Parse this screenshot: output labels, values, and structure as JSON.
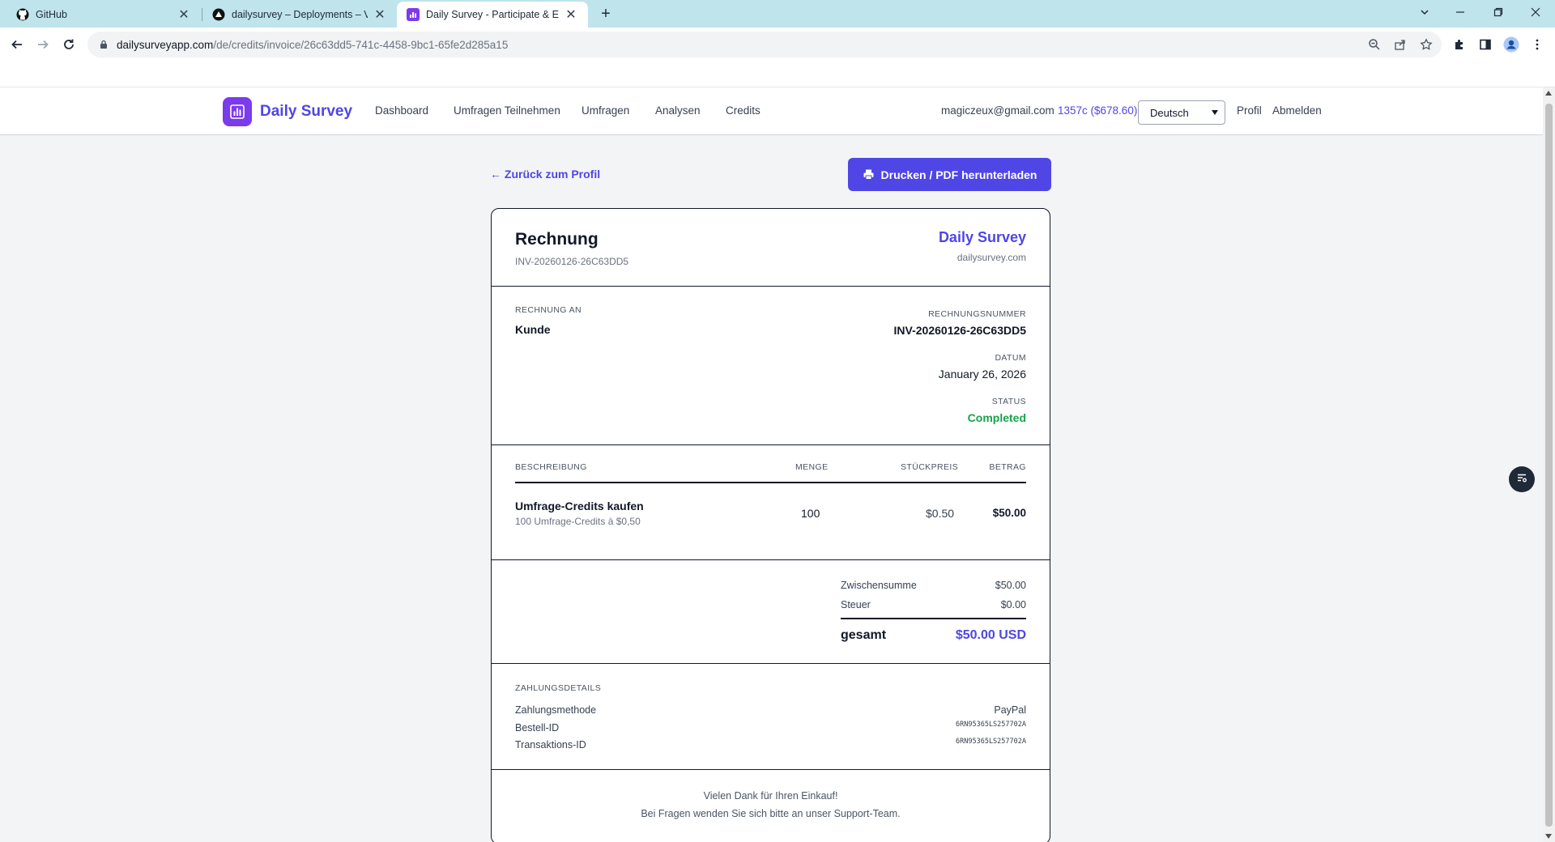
{
  "browser": {
    "tabs": [
      {
        "title": "GitHub",
        "icon": "github-icon"
      },
      {
        "title": "dailysurvey – Deployments – Ve",
        "icon": "vercel-icon"
      },
      {
        "title": "Daily Survey - Participate & Earn",
        "icon": "dailysurvey-favicon"
      }
    ],
    "url_host": "dailysurveyapp.com",
    "url_path": "/de/credits/invoice/26c63dd5-741c-4458-9bc1-65fe2d285a15"
  },
  "nav": {
    "brand": "Daily Survey",
    "links": [
      "Dashboard",
      "Umfragen Teilnehmen",
      "Umfragen",
      "Analysen",
      "Credits"
    ],
    "email": "magiczeux@gmail.com",
    "credits": "1357c ($678.60)",
    "language": "Deutsch",
    "profile": "Profil",
    "logout": "Abmelden"
  },
  "page": {
    "back_link": "← Zurück zum Profil",
    "print_button": "Drucken / PDF herunterladen"
  },
  "invoice": {
    "title": "Rechnung",
    "number_sub": "INV-20260126-26C63DD5",
    "brand": "Daily Survey",
    "domain": "dailysurvey.com",
    "bill_to_label": "RECHNUNG AN",
    "bill_to_value": "Kunde",
    "invoice_number_label": "RECHNUNGSNUMMER",
    "invoice_number": "INV-20260126-26C63DD5",
    "date_label": "DATUM",
    "date": "January 26, 2026",
    "status_label": "STATUS",
    "status": "Completed",
    "table": {
      "headers": [
        "BESCHREIBUNG",
        "MENGE",
        "STÜCKPREIS",
        "BETRAG"
      ],
      "rows": [
        {
          "description": "Umfrage-Credits kaufen",
          "detail": "100 Umfrage-Credits à $0,50",
          "quantity": "100",
          "unit_price": "$0.50",
          "amount": "$50.00"
        }
      ]
    },
    "totals": {
      "subtotal_label": "Zwischensumme",
      "subtotal": "$50.00",
      "tax_label": "Steuer",
      "tax": "$0.00",
      "total_label": "gesamt",
      "total": "$50.00 USD"
    },
    "payment": {
      "section_label": "ZAHLUNGSDETAILS",
      "method_label": "Zahlungsmethode",
      "method": "PayPal",
      "order_id_label": "Bestell-ID",
      "order_id": "6RN95365LS257702A",
      "transaction_id_label": "Transaktions-ID",
      "transaction_id": "6RN95365LS257702A"
    },
    "footer": {
      "line1": "Vielen Dank für Ihren Einkauf!",
      "line2": "Bei Fragen wenden Sie sich bitte an unser Support-Team."
    }
  },
  "colors": {
    "accent": "#4f46e5",
    "status_completed": "#16a34a",
    "tabstrip": "#bfe4ec"
  }
}
